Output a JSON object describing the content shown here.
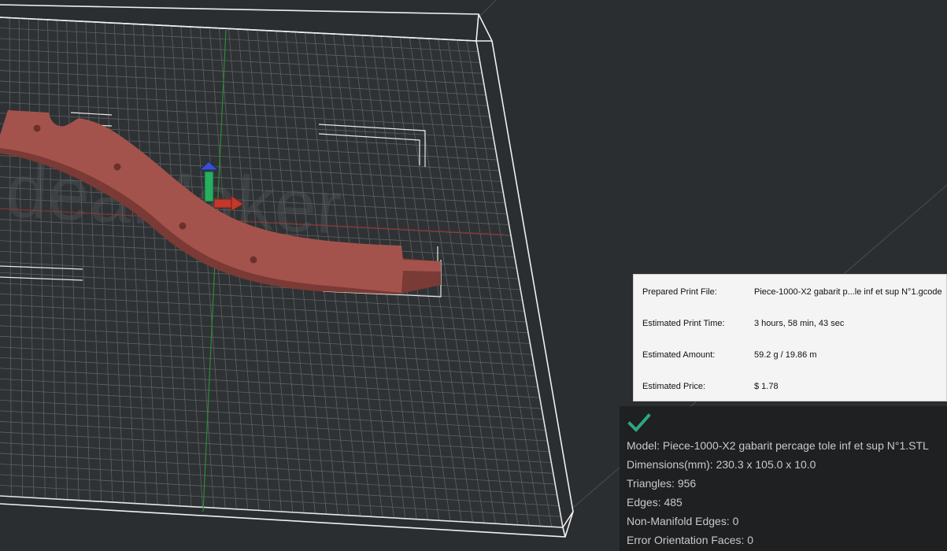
{
  "viewport": {
    "watermark": "IdeaMaker",
    "colors": {
      "background": "#2b2e30",
      "grid": "#6a6e70",
      "model": "#a4534c",
      "axis_x": "#c0392b",
      "axis_y": "#27ae60",
      "axis_z": "#3a4fc9"
    }
  },
  "print_info": {
    "rows": [
      {
        "label": "Prepared Print File:",
        "value": "Piece-1000-X2 gabarit p...le inf et sup N°1.gcode"
      },
      {
        "label": "Estimated Print Time:",
        "value": "3 hours, 58 min, 43 sec"
      },
      {
        "label": "Estimated Amount:",
        "value": "59.2 g / 19.86 m"
      },
      {
        "label": "Estimated Price:",
        "value": "$ 1.78"
      }
    ]
  },
  "model_info": {
    "status_icon": "check-icon",
    "status_color": "#2ea77f",
    "model": "Model: Piece-1000-X2 gabarit percage tole inf et sup N°1.STL",
    "dimensions": "Dimensions(mm): 230.3 x 105.0 x 10.0",
    "triangles": "Triangles: 956",
    "edges": "Edges: 485",
    "non_manifold": "Non-Manifold Edges: 0",
    "error_faces": "Error Orientation Faces: 0"
  }
}
